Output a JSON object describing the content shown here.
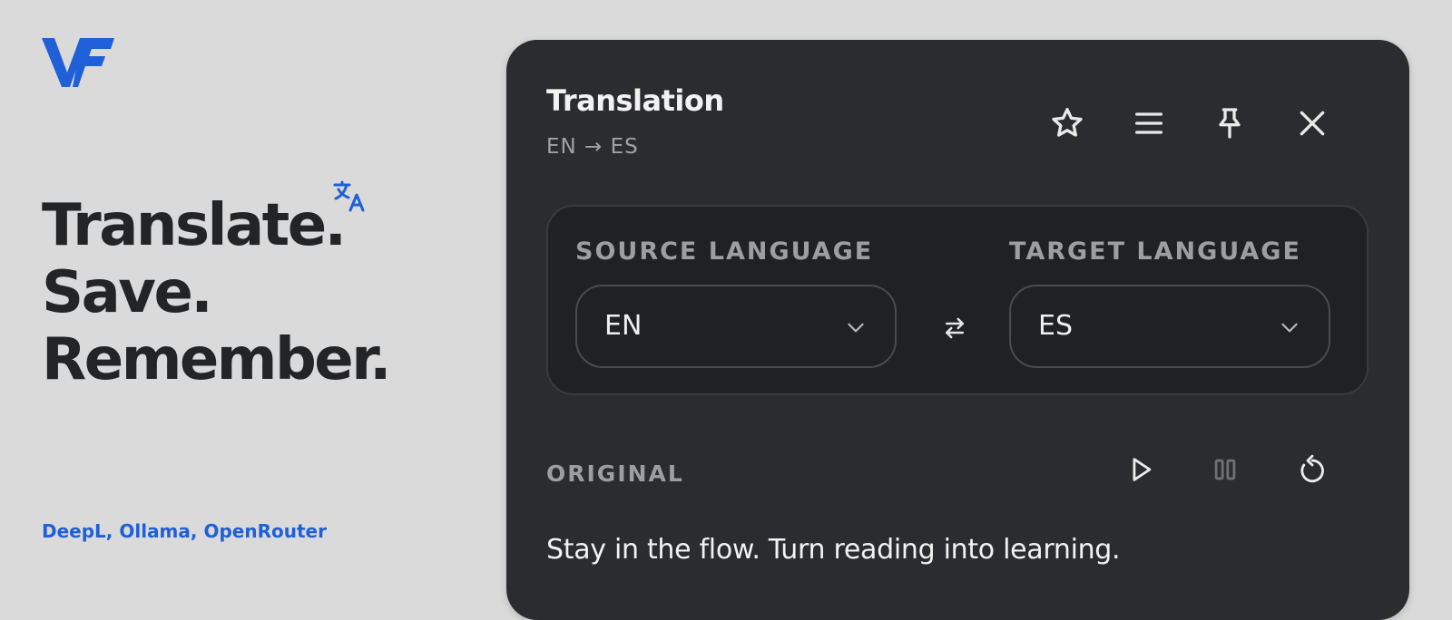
{
  "brand": {
    "logo_icon": "vf-logo-icon",
    "accent_color": "#1f5fd8",
    "headline_lines": [
      "Translate.",
      "Save.",
      "Remember."
    ],
    "translate_icon": "translate-icon",
    "providers": "DeepL, Ollama, OpenRouter"
  },
  "panel": {
    "title": "Translation",
    "subtitle": "EN → ES",
    "actions": [
      {
        "name": "favorite-button",
        "icon": "star-icon"
      },
      {
        "name": "menu-button",
        "icon": "menu-icon"
      },
      {
        "name": "pin-button",
        "icon": "pin-icon"
      },
      {
        "name": "close-button",
        "icon": "close-icon"
      }
    ],
    "languages": {
      "source_label": "SOURCE LANGUAGE",
      "source_value": "EN",
      "target_label": "TARGET LANGUAGE",
      "target_value": "ES",
      "swap_icon": "swap-icon"
    },
    "original": {
      "label": "ORIGINAL",
      "controls": [
        {
          "name": "play-button",
          "icon": "play-icon"
        },
        {
          "name": "pause-button",
          "icon": "pause-icon"
        },
        {
          "name": "replay-button",
          "icon": "replay-icon"
        }
      ],
      "text": "Stay in the flow. Turn reading into learning."
    }
  }
}
